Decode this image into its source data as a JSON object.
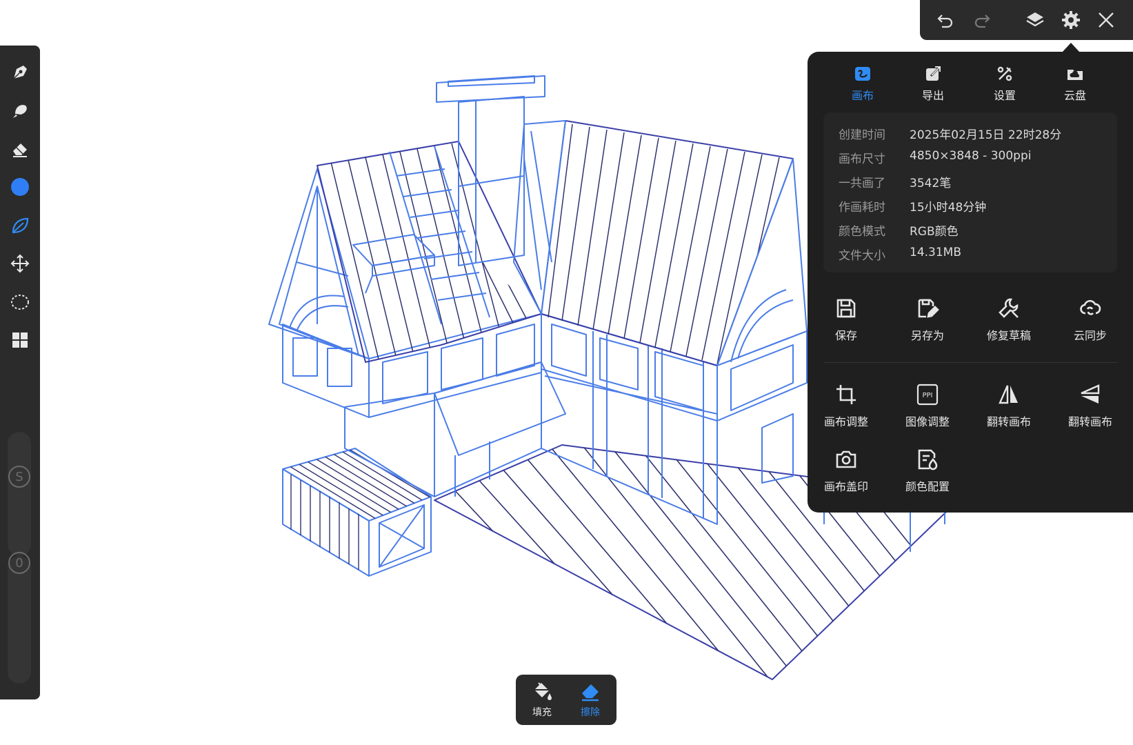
{
  "colors": {
    "accent": "#2f8cf5",
    "toolbar_bg": "#2b2b2b",
    "panel_bg": "#1f1f1f",
    "sketch_blue": "#4a7de8",
    "sketch_dark": "#3a3fa8"
  },
  "left_toolbar": {
    "tools": [
      {
        "name": "pen-icon"
      },
      {
        "name": "smudge-brush-icon"
      },
      {
        "name": "eraser-icon"
      },
      {
        "name": "color-swatch",
        "color": "#2f7ef5"
      },
      {
        "name": "leaf-brush-icon"
      },
      {
        "name": "move-transform-icon"
      },
      {
        "name": "lasso-select-icon"
      },
      {
        "name": "layers-grid-icon"
      }
    ],
    "size_slider_label": "S",
    "opacity_slider_label": "0"
  },
  "top_toolbar": {
    "buttons": [
      "undo-icon",
      "redo-icon",
      "layers-icon",
      "settings-icon",
      "close-icon"
    ]
  },
  "panel": {
    "tabs": [
      {
        "label": "画布",
        "icon": "canvas-icon",
        "active": true
      },
      {
        "label": "导出",
        "icon": "export-icon",
        "active": false
      },
      {
        "label": "设置",
        "icon": "tools-icon",
        "active": false
      },
      {
        "label": "云盘",
        "icon": "cloud-folder-icon",
        "active": false
      }
    ],
    "info": [
      {
        "key": "创建时间",
        "value": "2025年02月15日 22时28分"
      },
      {
        "key": "画布尺寸",
        "value": "4850×3848 - 300ppi"
      },
      {
        "key": "一共画了",
        "value": "3542笔"
      },
      {
        "key": "作画耗时",
        "value": "15小时48分钟"
      },
      {
        "key": "颜色模式",
        "value": "RGB颜色"
      },
      {
        "key": "文件大小",
        "value": "14.31MB"
      }
    ],
    "actions_row1": [
      {
        "label": "保存",
        "icon": "save-icon"
      },
      {
        "label": "另存为",
        "icon": "save-as-icon"
      },
      {
        "label": "修复草稿",
        "icon": "wrench-icon"
      },
      {
        "label": "云同步",
        "icon": "cloud-sync-icon"
      }
    ],
    "actions_row2": [
      {
        "label": "画布调整",
        "icon": "crop-icon"
      },
      {
        "label": "图像调整",
        "icon": "ppi-icon"
      },
      {
        "label": "翻转画布",
        "icon": "flip-horizontal-icon"
      },
      {
        "label": "翻转画布",
        "icon": "flip-vertical-icon"
      }
    ],
    "actions_row3": [
      {
        "label": "画布盖印",
        "icon": "camera-icon"
      },
      {
        "label": "颜色配置",
        "icon": "color-profile-icon"
      }
    ]
  },
  "bottom_bar": {
    "fill_label": "填充",
    "erase_label": "擦除",
    "active": "erase"
  }
}
